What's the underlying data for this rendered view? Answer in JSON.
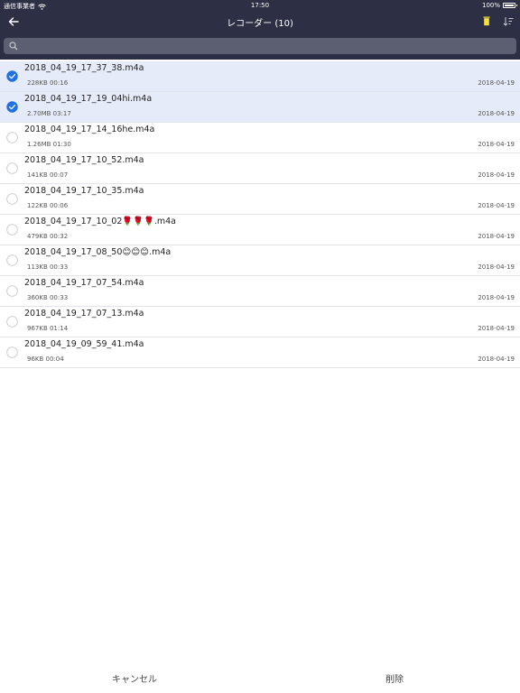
{
  "status": {
    "carrier": "通信事業者",
    "time": "17:50",
    "battery": "100%",
    "battery_level": 1.0
  },
  "nav": {
    "title": "レコーダー (10)",
    "trash_color": "#f5e23b"
  },
  "search": {
    "placeholder": "",
    "value": ""
  },
  "files": [
    {
      "name": "2018_04_19_17_37_38.m4a",
      "meta": "228KB 00:16",
      "date": "2018-04-19",
      "selected": true
    },
    {
      "name": "2018_04_19_17_19_04hi.m4a",
      "meta": "2.70MB 03:17",
      "date": "2018-04-19",
      "selected": true
    },
    {
      "name": "2018_04_19_17_14_16he.m4a",
      "meta": "1.26MB 01:30",
      "date": "2018-04-19",
      "selected": false
    },
    {
      "name": "2018_04_19_17_10_52.m4a",
      "meta": "141KB 00:07",
      "date": "2018-04-19",
      "selected": false
    },
    {
      "name": "2018_04_19_17_10_35.m4a",
      "meta": "122KB 00:06",
      "date": "2018-04-19",
      "selected": false
    },
    {
      "name": "2018_04_19_17_10_02🌹🌹🌹.m4a",
      "meta": "479KB 00:32",
      "date": "2018-04-19",
      "selected": false
    },
    {
      "name": "2018_04_19_17_08_50😊😊😊.m4a",
      "meta": "113KB 00:33",
      "date": "2018-04-19",
      "selected": false
    },
    {
      "name": "2018_04_19_17_07_54.m4a",
      "meta": "360KB 00:33",
      "date": "2018-04-19",
      "selected": false
    },
    {
      "name": "2018_04_19_17_07_13.m4a",
      "meta": "967KB 01:14",
      "date": "2018-04-19",
      "selected": false
    },
    {
      "name": "2018_04_19_09_59_41.m4a",
      "meta": "96KB 00:04",
      "date": "2018-04-19",
      "selected": false
    }
  ],
  "bottom": {
    "cancel_label": "キャンセル",
    "delete_label": "削除"
  },
  "colors": {
    "header_bg": "#2d2f45",
    "selected_bg": "#e6ebf9",
    "check_blue": "#1f6fe5"
  }
}
